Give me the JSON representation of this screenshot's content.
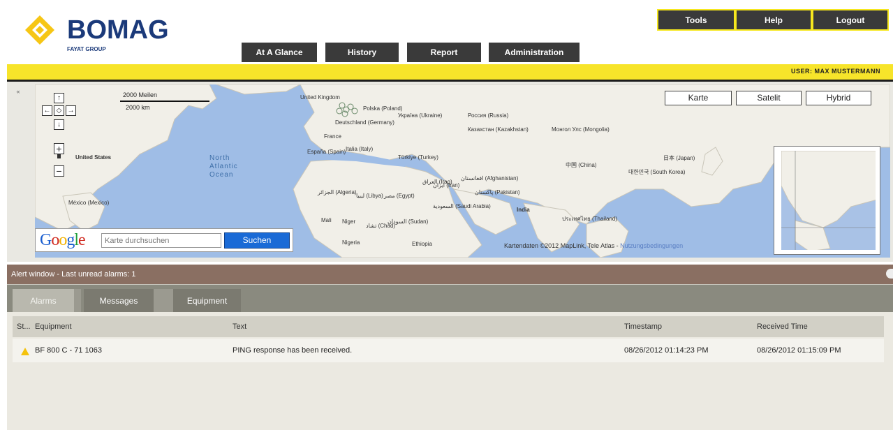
{
  "brand": {
    "name": "BOMAG",
    "subtitle": "FAYAT GROUP"
  },
  "nav": {
    "at_a_glance": "At A Glance",
    "history": "History",
    "report": "Report",
    "administration": "Administration"
  },
  "tools": {
    "tools": "Tools",
    "help": "Help",
    "logout": "Logout"
  },
  "user": {
    "label": "USER: MAX MUSTERMANN"
  },
  "map": {
    "scale_metric": "2000 Meilen",
    "scale_km": "2000 km",
    "map_types": [
      "Karte",
      "Satelit",
      "Hybrid"
    ],
    "search_placeholder": "Karte durchsuchen",
    "search_button": "Suchen",
    "google": "Google",
    "copyright": "Kartendaten ©2012 MapLink, Tele Atlas - ",
    "copyright_link": "Nutzungsbedingungen",
    "labels": {
      "north_atlantic": "Nordatlantischer Ozean",
      "united_states": "United States",
      "mexico": "México (Mexico)",
      "united_kingdom": "United Kingdom",
      "deutschland": "Deutschland (Germany)",
      "france": "France",
      "polska": "Polska (Poland)",
      "ukraine": "Україна (Ukraine)",
      "turkiye": "Türkiye (Turkey)",
      "russia": "Россия (Russia)",
      "kazakhstan": "Казахстан (Kazakhstan)",
      "mongolia": "Монгол Улс (Mongolia)",
      "china": "中国 (China)",
      "japan": "日本 (Japan)",
      "korea": "대한민국 (South Korea)",
      "india": "India",
      "afghanistan": "افغانستان (Afghanistan)",
      "pakistan": "پاکستان (Pakistan)",
      "iran": "ایران (Iran)",
      "iraq": "العراق (Iraq)",
      "egypt": "مصر (Egypt)",
      "libya": "ليبيا (Libya)",
      "algeria": "الجزائر (Algeria)",
      "mali": "Mali",
      "niger": "Niger",
      "chad": "تشاد (Chad)",
      "sudan": "السودان (Sudan)",
      "saudi": "السعودية (Saudi Arabia)",
      "nigeria": "Nigeria",
      "ethiopia": "Ethiopia",
      "thailand": "ประเทศไทย (Thailand)",
      "espana": "España (Spain)",
      "italia": "Italia (Italy)"
    }
  },
  "alert": {
    "title": "Alert window - Last unread alarms: 1"
  },
  "tabs": {
    "alarms": "Alarms",
    "messages": "Messages",
    "equipment": "Equipment"
  },
  "grid": {
    "columns": [
      "St...",
      "Equipment",
      "Text",
      "Timestamp",
      "Received Time"
    ],
    "rows": [
      {
        "equipment": "BF 800 C - 71 1063",
        "text": "PING response has been received.",
        "timestamp": "08/26/2012 01:14:23 PM",
        "received": "08/26/2012 01:15:09 PM"
      }
    ]
  },
  "colors": {
    "navy": "#1b3a7a",
    "yellow": "#f7e42a",
    "dark_button": "#3a3a3a",
    "alert_header": "#8a6f62",
    "map_water": "#9fbde6"
  }
}
